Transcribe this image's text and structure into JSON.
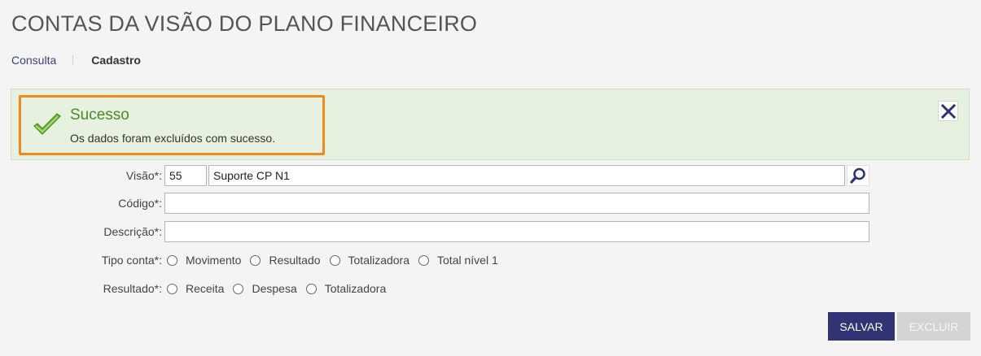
{
  "page": {
    "title": "CONTAS DA VISÃO DO PLANO FINANCEIRO"
  },
  "tabs": {
    "consulta": "Consulta",
    "cadastro": "Cadastro"
  },
  "alert": {
    "title": "Sucesso",
    "message": "Os dados foram excluídos com sucesso.",
    "highlight_color": "#f28a1a",
    "icon": "check-icon"
  },
  "form": {
    "visao": {
      "label": "Visão*:",
      "code": "55",
      "name": "Suporte CP N1"
    },
    "codigo": {
      "label": "Código*:",
      "value": ""
    },
    "descricao": {
      "label": "Descrição*:",
      "value": ""
    },
    "tipo_conta": {
      "label": "Tipo conta*:",
      "options": [
        "Movimento",
        "Resultado",
        "Totalizadora",
        "Total nível 1"
      ]
    },
    "resultado": {
      "label": "Resultado*:",
      "options": [
        "Receita",
        "Despesa",
        "Totalizadora"
      ]
    }
  },
  "buttons": {
    "salvar": "SALVAR",
    "excluir": "EXCLUIR"
  },
  "colors": {
    "primary": "#2f3574",
    "success_bg": "#e6f1df",
    "success_text": "#4a8a2b"
  }
}
